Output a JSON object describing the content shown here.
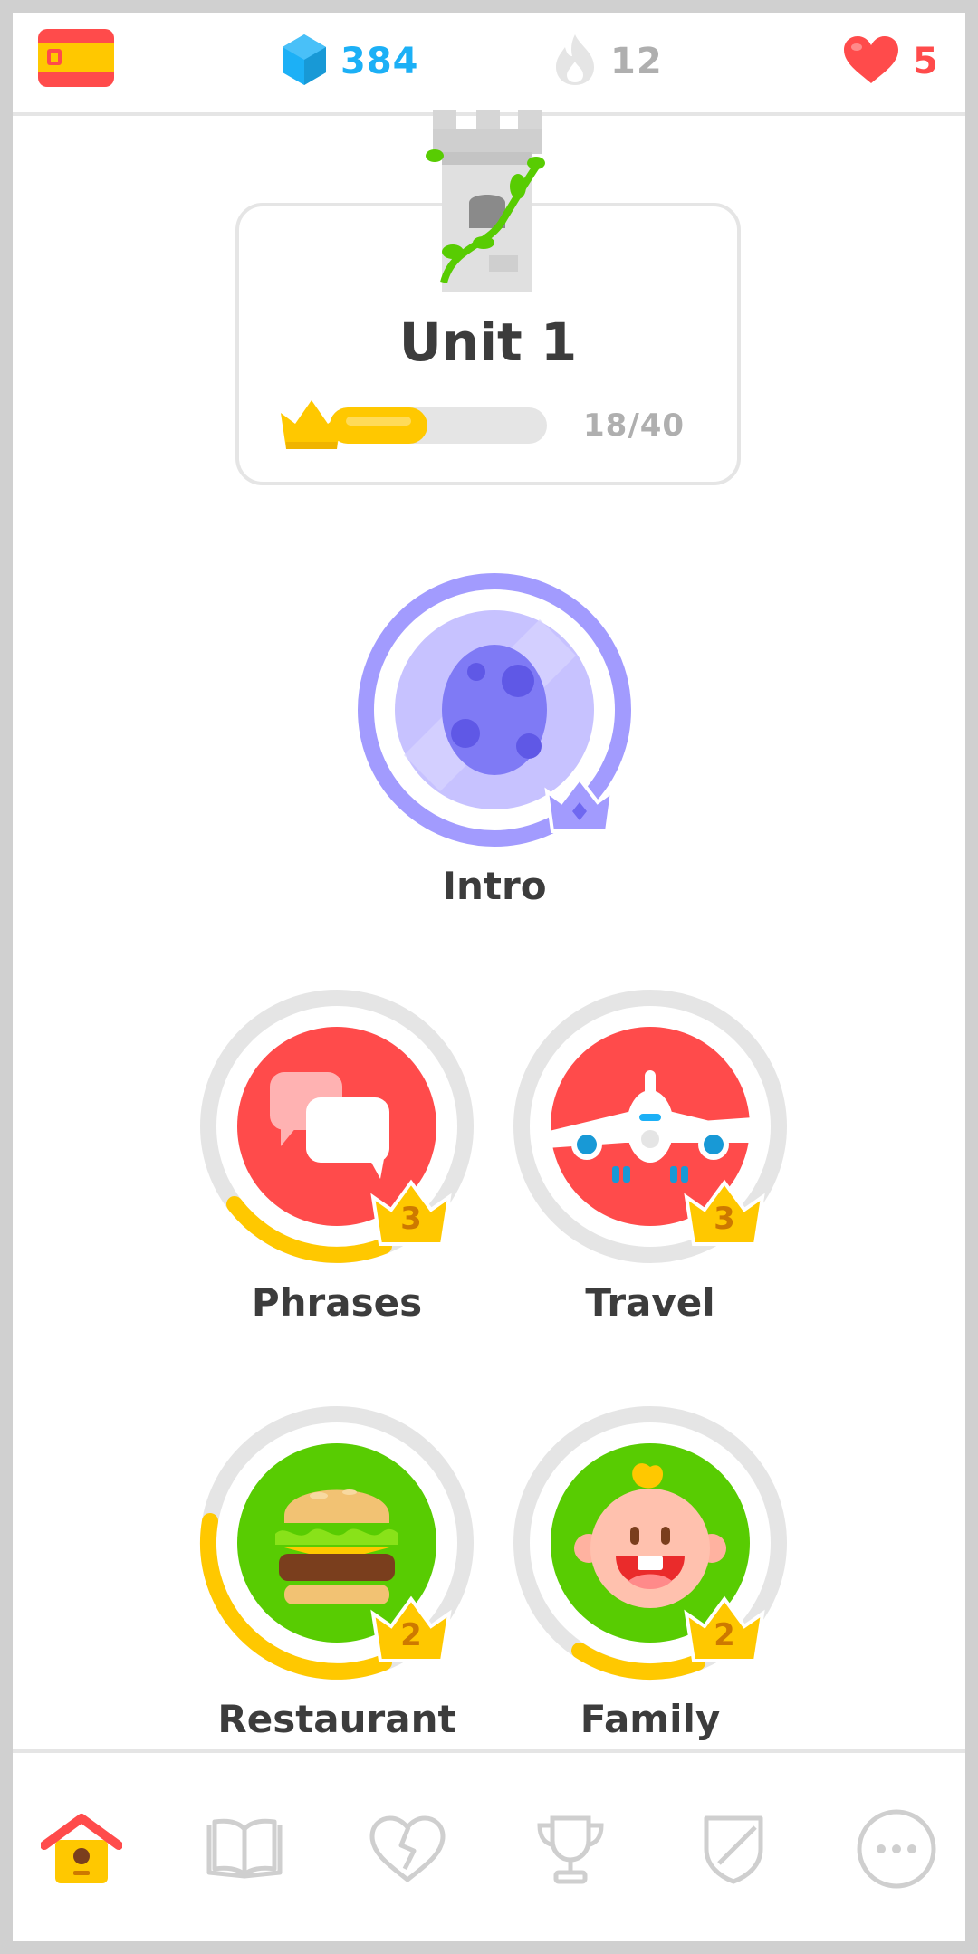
{
  "header": {
    "language_flag": "spain-flag",
    "gems": "384",
    "streak": "12",
    "hearts": "5"
  },
  "unit": {
    "title": "Unit 1",
    "progress_text": "18/40",
    "progress_fraction": 0.45
  },
  "skills": [
    {
      "name": "Intro",
      "level": "",
      "icon": "egg-icon",
      "state": "legendary"
    },
    {
      "name": "Phrases",
      "level": "3",
      "icon": "speech-bubbles-icon"
    },
    {
      "name": "Travel",
      "level": "3",
      "icon": "airplane-icon"
    },
    {
      "name": "Restaurant",
      "level": "2",
      "icon": "hamburger-icon"
    },
    {
      "name": "Family",
      "level": "2",
      "icon": "baby-icon"
    }
  ],
  "nav": [
    {
      "name": "learn",
      "icon": "home-icon",
      "active": true
    },
    {
      "name": "stories",
      "icon": "book-icon"
    },
    {
      "name": "practice",
      "icon": "broken-heart-icon"
    },
    {
      "name": "leaderboards",
      "icon": "trophy-icon"
    },
    {
      "name": "shop",
      "icon": "shield-icon"
    },
    {
      "name": "more",
      "icon": "more-icon"
    }
  ],
  "colors": {
    "gem_blue": "#1cb0f6",
    "heart_red": "#ff4b4b",
    "gold": "#ffc800",
    "skill_red": "#ff4b4b",
    "skill_green": "#58cc02",
    "legendary_purple": "#a29bfe",
    "border_gray": "#e5e5e5"
  }
}
